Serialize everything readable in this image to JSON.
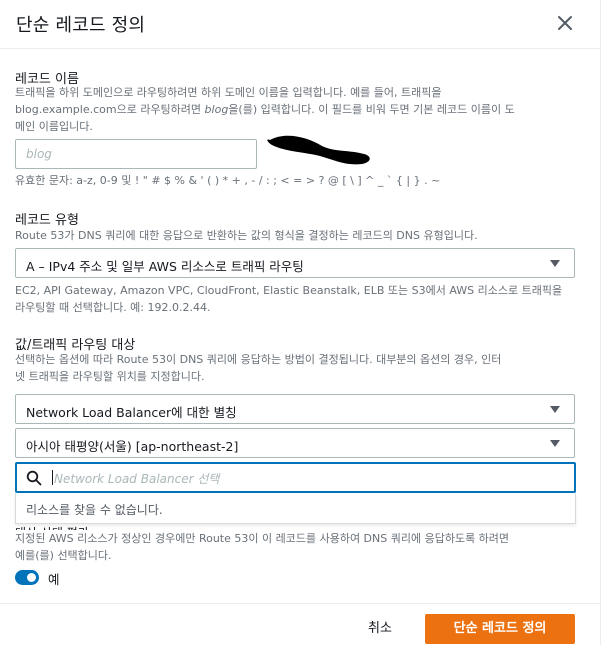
{
  "dialog": {
    "title": "단순 레코드 정의",
    "close_icon": "close-icon"
  },
  "record_name": {
    "label": "레코드 이름",
    "desc_line1": "트래픽을 하위 도메인으로 라우팅하려면 하위 도메인 이름을 입력합니다. 예를 들어, 트래픽을",
    "desc_line2a": "blog.example.com으로 라우팅하려면 ",
    "desc_line2_italic": "blog",
    "desc_line2b": "을(를) 입력합니다. 이 필드를 비워 두면 기본 레코드 이름이 도",
    "desc_line3": "메인 이름입니다.",
    "placeholder": "blog",
    "valid_chars": "유효한 문자: a-z, 0-9 및 ! \" # $ % & ' ( ) * + , - / : ; < = > ? @ [ \\ ] ^ _ ` { | } . ~"
  },
  "record_type": {
    "label": "레코드 유형",
    "desc": "Route 53가 DNS 쿼리에 대한 응답으로 반환하는 값의 형식을 결정하는 레코드의 DNS 유형입니다.",
    "selected": "A – IPv4 주소 및 일부 AWS 리소스로 트래픽 라우팅",
    "help_line1": "EC2, API Gateway, Amazon VPC, CloudFront, Elastic Beanstalk, ELB 또는 S3에서 AWS 리소스로 트래픽을",
    "help_line2": "라우팅할 때 선택합니다. 예: 192.0.2.44."
  },
  "routing_target": {
    "label": "값/트래픽 라우팅 대상",
    "desc_line1": "선택하는 옵션에 따라 Route 53이 DNS 쿼리에 응답하는 방법이 결정됩니다. 대부분의 옵션의 경우, 인터",
    "desc_line2": "넷 트래픽을 라우팅할 위치를 지정합니다.",
    "endpoint_selected": "Network Load Balancer에 대한 별칭",
    "region_selected": "아시아 태평양(서울) [ap-northeast-2]",
    "search_placeholder": "Network Load Balancer 선택",
    "no_results": "리소스를 찾을 수 없습니다."
  },
  "health": {
    "label_partial": "대상 상태 평가",
    "desc_line1": "지정된 AWS 리소스가 정상인 경우에만 Route 53이 이 레코드를 사용하여 DNS 쿼리에 응답하도록 하려면",
    "desc_line2": "예를(를) 선택합니다.",
    "toggle_label": "예",
    "toggle_on": true
  },
  "footer": {
    "cancel": "취소",
    "submit": "단순 레코드 정의"
  },
  "colors": {
    "primary": "#ec7211",
    "focus": "#0073bb",
    "text": "#16191f",
    "muted": "#687078"
  }
}
